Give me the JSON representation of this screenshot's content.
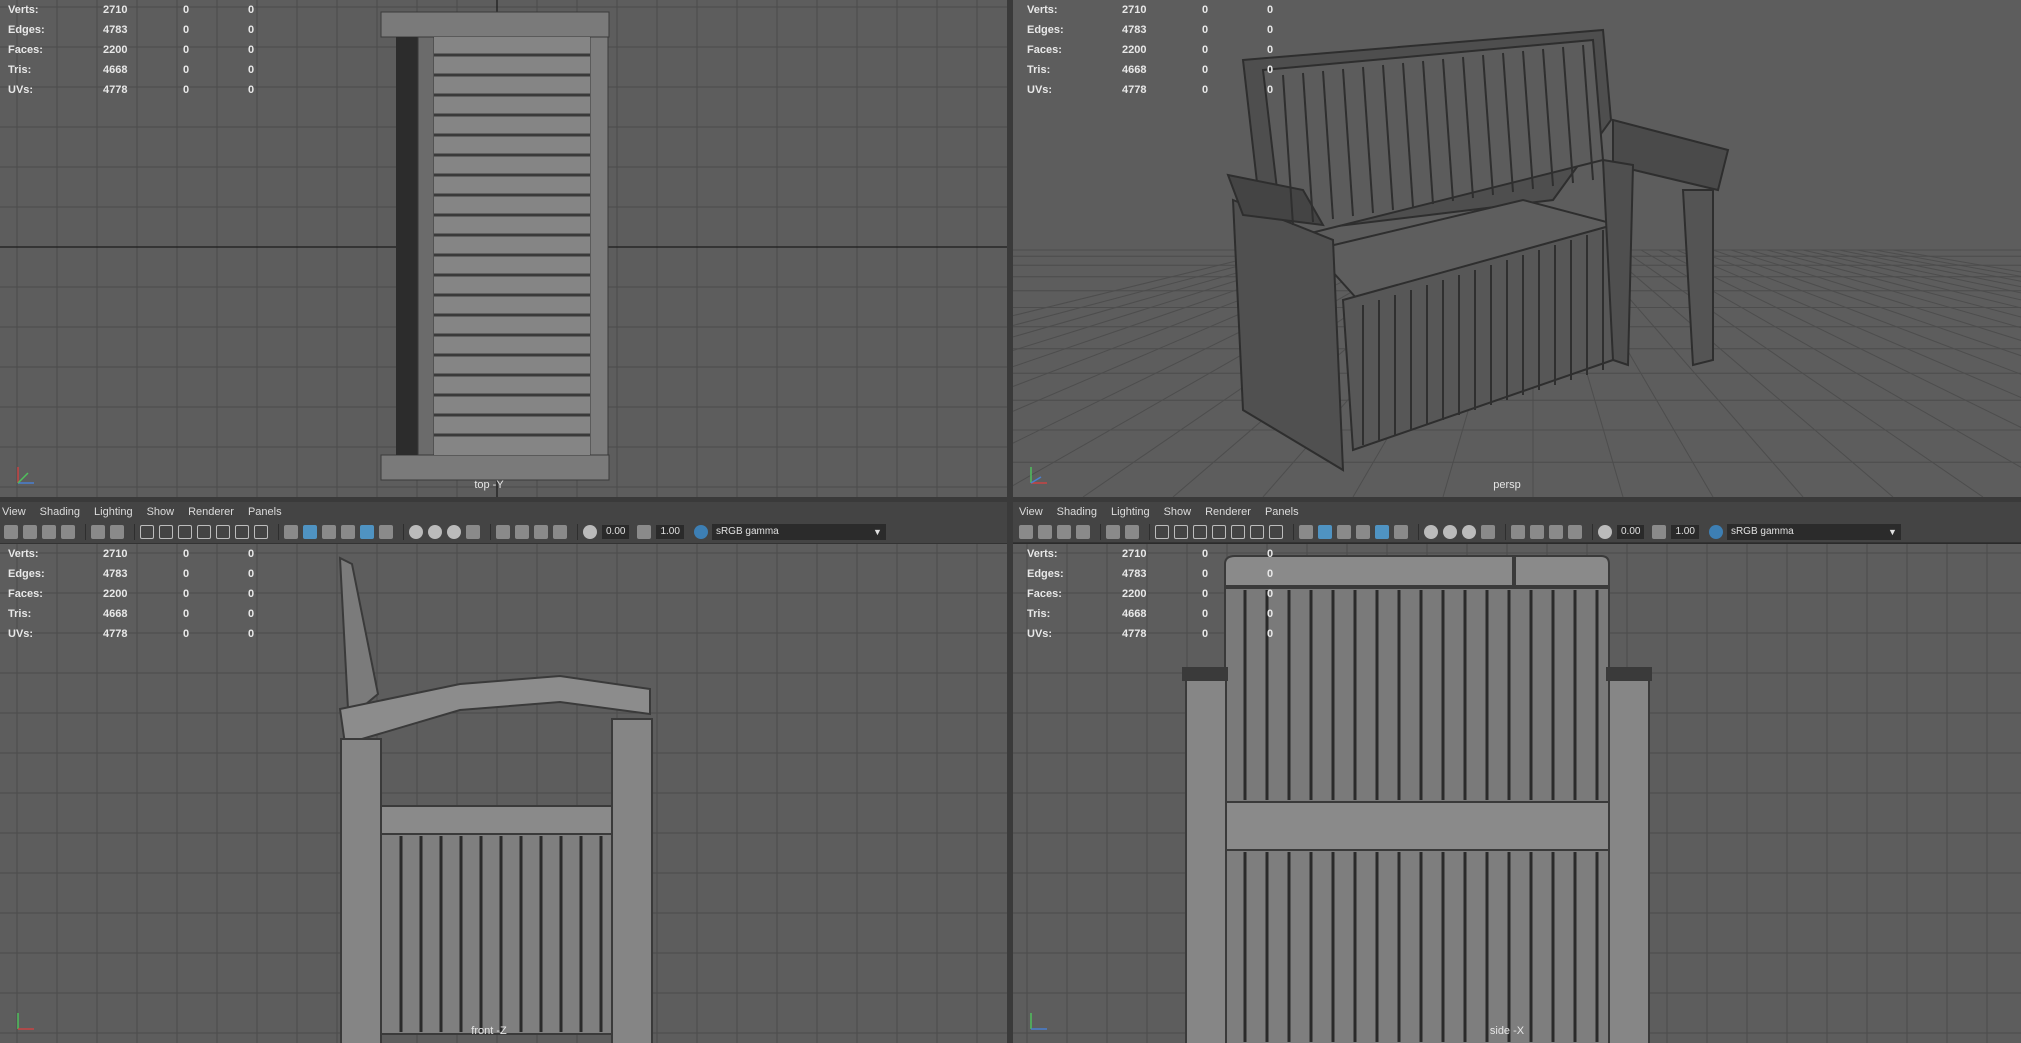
{
  "hud": {
    "rows": [
      {
        "label": "Verts:",
        "v1": "2710",
        "v2": "0",
        "v3": "0"
      },
      {
        "label": "Edges:",
        "v1": "4783",
        "v2": "0",
        "v3": "0"
      },
      {
        "label": "Faces:",
        "v1": "2200",
        "v2": "0",
        "v3": "0"
      },
      {
        "label": "Tris:",
        "v1": "4668",
        "v2": "0",
        "v3": "0"
      },
      {
        "label": "UVs:",
        "v1": "4778",
        "v2": "0",
        "v3": "0"
      }
    ]
  },
  "viewports": {
    "top": {
      "label": "top -Y"
    },
    "persp": {
      "label": "persp"
    },
    "front": {
      "label": "front -Z"
    },
    "side": {
      "label": "side -X"
    }
  },
  "panel_menu": {
    "items": [
      "View",
      "Shading",
      "Lighting",
      "Show",
      "Renderer",
      "Panels"
    ]
  },
  "panel_toolbar": {
    "exposure": "0.00",
    "gamma": "1.00",
    "colorspace": "sRGB gamma"
  },
  "colors": {
    "viewport_bg": "#5d5d5d",
    "grid": "#4a4a4a",
    "grid_axis": "#262626",
    "toolbar_bg": "#444444",
    "accent": "#4f93c2"
  },
  "icons": [
    "camera-icon",
    "grid-icon",
    "wireframe-icon",
    "smooth-shade-icon",
    "texture-icon",
    "light-icon",
    "shadow-icon",
    "isolate-icon",
    "exposure-icon",
    "gamma-icon",
    "colorspace-icon"
  ]
}
